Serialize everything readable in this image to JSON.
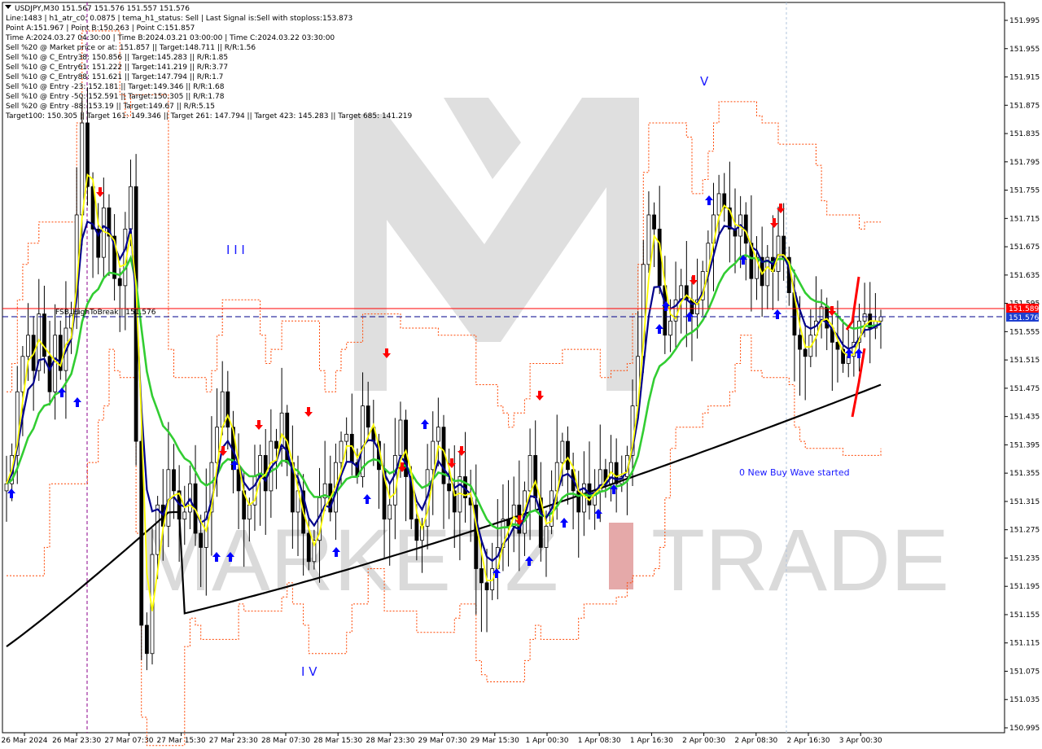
{
  "header": {
    "symbol_line": "USDJPY,M30  151.567 151.576 151.557 151.576",
    "lines": [
      "Line:1483  |  h1_atr_c0: 0.0875  |  tema_h1_status: Sell  |  Last Signal is:Sell with stoploss:153.873",
      "Point A:151.967  |  Point B:150.263  |  Point C:151.857",
      "Time A:2024.03.27 04:30:00  |  Time B:2024.03.21 03:00:00  |  Time C:2024.03.22 03:30:00",
      "Sell %20 @ Market price or at: 151.857  ||  Target:148.711  ||  R/R:1.56",
      "Sell %10 @ C_Entry38: 150.856  ||  Target:145.283  ||  R/R:1.85",
      "Sell %10 @ C_Entry61: 151.222  ||  Target:141.219  ||  R/R:3.77",
      "Sell %10 @ C_Entry88: 151.621  ||  Target:147.794  ||  R/R:1.7",
      "Sell %10 @ Entry -23: 152.181  ||  Target:149.346  ||  R/R:1.68",
      "Sell %10 @ Entry -50: 152.591  ||  Target:150.305  ||  R/R:1.78",
      "Sell %20 @ Entry -88: 153.19  ||  Target:149.67  ||  R/R:5.15",
      "Target100: 150.305  ||  Target 161: 149.346  ||  Target 261: 147.794  ||  Target 423: 145.283  ||  Target 685: 141.219"
    ]
  },
  "annotations": {
    "wave_iii": "I I I",
    "wave_iv": "I V",
    "wave_v": "V",
    "new_wave": "0 New Buy Wave started",
    "fsb_label": "FSB_HighToBreak  |  151.576"
  },
  "watermark": {
    "left": "MARKETZ",
    "right": "TRADE"
  },
  "price_tags": {
    "red_value": "151.589",
    "blue_value": "151.576"
  },
  "colors": {
    "candle": "#000000",
    "yellow_line": "#ffff00",
    "navy_line": "#00008b",
    "green_line": "#32cd32",
    "black_ma": "#000000",
    "red_channel": "#ff4500",
    "buy_arrow": "#0000ff",
    "sell_arrow": "#ff0000",
    "fsb_line": "#ff0000",
    "blue_dash": "#00008b"
  },
  "chart_data": {
    "type": "candlestick",
    "symbol": "USDJPY",
    "timeframe": "M30",
    "ylim": [
      150.995,
      151.995
    ],
    "y_ticks": [
      "151.995",
      "151.955",
      "151.915",
      "151.875",
      "151.835",
      "151.795",
      "151.755",
      "151.715",
      "151.675",
      "151.635",
      "151.595",
      "151.555",
      "151.515",
      "151.475",
      "151.435",
      "151.395",
      "151.355",
      "151.315",
      "151.275",
      "151.235",
      "151.195",
      "151.155",
      "151.115",
      "151.075",
      "151.035",
      "150.995"
    ],
    "x_ticks": [
      "26 Mar 2024",
      "26 Mar 23:30",
      "27 Mar 07:30",
      "27 Mar 15:30",
      "27 Mar 23:30",
      "28 Mar 07:30",
      "28 Mar 15:30",
      "28 Mar 23:30",
      "29 Mar 07:30",
      "29 Mar 15:30",
      "1 Apr 00:30",
      "1 Apr 08:30",
      "1 Apr 16:30",
      "2 Apr 00:30",
      "2 Apr 08:30",
      "2 Apr 16:30",
      "3 Apr 00:30"
    ],
    "closes": [
      151.34,
      151.38,
      151.47,
      151.52,
      151.55,
      151.5,
      151.58,
      151.52,
      151.47,
      151.55,
      151.5,
      151.56,
      151.58,
      151.72,
      151.85,
      151.76,
      151.7,
      151.66,
      151.73,
      151.69,
      151.63,
      151.62,
      151.7,
      151.76,
      151.4,
      151.14,
      151.1,
      151.24,
      151.31,
      151.28,
      151.36,
      151.33,
      151.29,
      151.3,
      151.34,
      151.27,
      151.25,
      151.3,
      151.37,
      151.42,
      151.47,
      151.42,
      151.36,
      151.33,
      151.29,
      151.31,
      151.35,
      151.38,
      151.33,
      151.4,
      151.39,
      151.44,
      151.37,
      151.3,
      151.33,
      151.27,
      151.23,
      151.26,
      151.32,
      151.34,
      151.3,
      151.37,
      151.4,
      151.41,
      151.37,
      151.35,
      151.45,
      151.42,
      151.4,
      151.36,
      151.29,
      151.31,
      151.38,
      151.43,
      151.35,
      151.29,
      151.26,
      151.28,
      151.36,
      151.4,
      151.42,
      151.34,
      151.33,
      151.3,
      151.35,
      151.32,
      151.31,
      151.22,
      151.2,
      151.19,
      151.22,
      151.25,
      151.29,
      151.28,
      151.31,
      151.27,
      151.33,
      151.38,
      151.32,
      151.25,
      151.28,
      151.33,
      151.37,
      151.4,
      151.36,
      151.33,
      151.3,
      151.34,
      151.31,
      151.33,
      151.36,
      151.34,
      151.37,
      151.34,
      151.35,
      151.38,
      151.45,
      151.52,
      151.65,
      151.72,
      151.7,
      151.62,
      151.55,
      151.57,
      151.6,
      151.62,
      151.6,
      151.58,
      151.6,
      151.64,
      151.68,
      151.72,
      151.75,
      151.73,
      151.7,
      151.69,
      151.72,
      151.68,
      151.63,
      151.66,
      151.62,
      151.66,
      151.64,
      151.69,
      151.66,
      151.61,
      151.55,
      151.53,
      151.52,
      151.55,
      151.57,
      151.59,
      151.56,
      151.54,
      151.53,
      151.51,
      151.52,
      151.54,
      151.57,
      151.58,
      151.56,
      151.57,
      151.576
    ],
    "ma200_end": 151.48,
    "fsb_high_to_break": 151.576,
    "red_level": 151.589
  }
}
